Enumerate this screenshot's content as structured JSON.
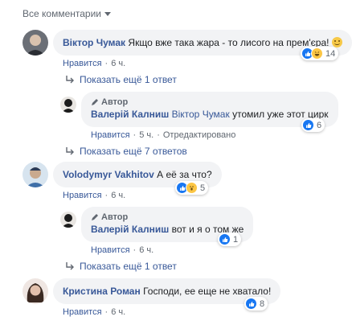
{
  "filter": {
    "label": "Все комментарии"
  },
  "comments": [
    {
      "author": "Віктор Чумак",
      "text": "Якщо вже така жара - то лисого на прем'єра!",
      "like_label": "Нравится",
      "time": "6 ч.",
      "reactions_count": "14"
    },
    {
      "author": "Volodymyr Vakhitov",
      "text": "А её за что?",
      "like_label": "Нравится",
      "time": "6 ч.",
      "reactions_count": "5"
    },
    {
      "author": "Кристина Роман",
      "text": "Господи, ее еще не хватало!",
      "like_label": "Нравится",
      "time": "6 ч.",
      "reactions_count": "8"
    }
  ],
  "replies": [
    {
      "badge": "Автор",
      "author": "Валерій Калниш",
      "mention": "Віктор Чумак",
      "text": "утомил уже этот цирк",
      "like_label": "Нравится",
      "time": "5 ч.",
      "edited": "Отредактировано",
      "reactions_count": "6"
    },
    {
      "badge": "Автор",
      "author": "Валерій Калниш",
      "text": "вот и я о том же",
      "like_label": "Нравится",
      "time": "6 ч.",
      "reactions_count": "1"
    }
  ],
  "more_replies": [
    {
      "label": "Показать ещё 1 ответ"
    },
    {
      "label": "Показать ещё 7 ответов"
    },
    {
      "label": "Показать ещё 1 ответ"
    }
  ],
  "colors": {
    "link": "#385898",
    "meta": "#606770",
    "bubble": "#f2f3f5",
    "like": "#1877f2"
  },
  "icons": [
    "chevron-down-icon",
    "reply-arrow-icon",
    "pencil-icon",
    "like-reaction-icon",
    "haha-reaction-icon",
    "wow-reaction-icon",
    "smile-emoji-icon"
  ]
}
